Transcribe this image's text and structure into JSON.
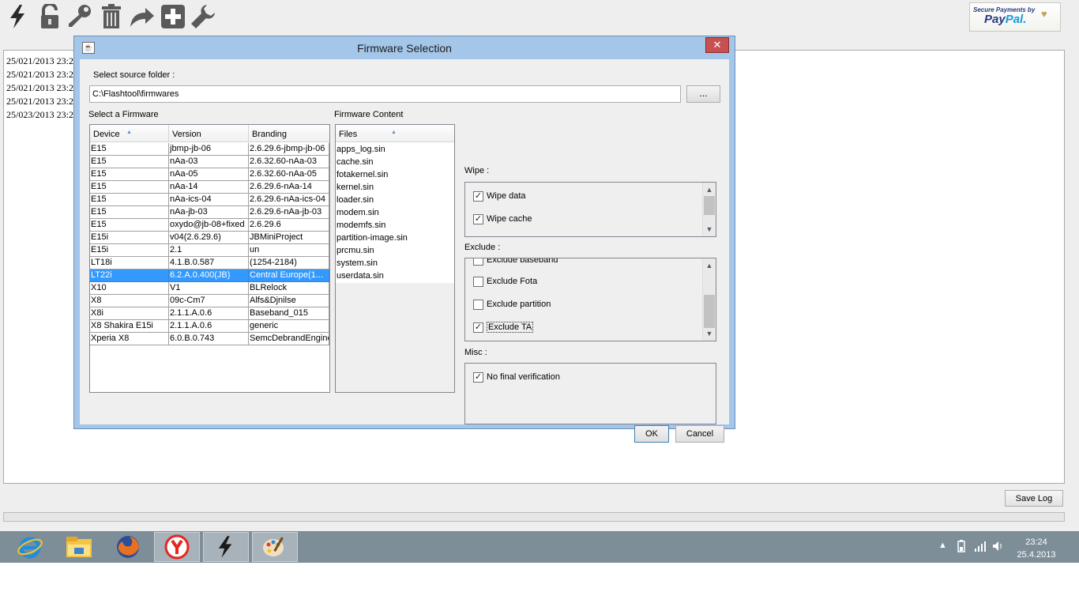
{
  "toolbar": {
    "icons": [
      "flash-icon",
      "unlock-icon",
      "key-icon",
      "trash-icon",
      "redo-arrow-icon",
      "plus-icon",
      "wrench-icon"
    ]
  },
  "paypal": {
    "small": "Secure Payments by",
    "pay": "Pay",
    "pal": "Pal."
  },
  "log": {
    "lines": [
      "25/021/2013 23:2",
      "25/021/2013 23:2",
      "25/021/2013 23:2",
      "25/021/2013 23:2",
      "25/023/2013 23:2"
    ],
    "save_label": "Save Log"
  },
  "dialog": {
    "title": "Firmware Selection",
    "close": "✕",
    "source_label": "Select source folder :",
    "source_path": "C:\\Flashtool\\firmwares",
    "browse_label": "...",
    "select_label": "Select a Firmware",
    "content_label": "Firmware Content",
    "columns": [
      "Device",
      "Version",
      "Branding"
    ],
    "rows": [
      [
        "E15",
        "jbmp-jb-06",
        "2.6.29.6-jbmp-jb-06"
      ],
      [
        "E15",
        "nAa-03",
        "2.6.32.60-nAa-03"
      ],
      [
        "E15",
        "nAa-05",
        "2.6.32.60-nAa-05"
      ],
      [
        "E15",
        "nAa-14",
        "2.6.29.6-nAa-14"
      ],
      [
        "E15",
        "nAa-ics-04",
        "2.6.29.6-nAa-ics-04"
      ],
      [
        "E15",
        "nAa-jb-03",
        "2.6.29.6-nAa-jb-03"
      ],
      [
        "E15",
        "oxydo@jb-08+fixed",
        "2.6.29.6"
      ],
      [
        "E15i",
        "v04(2.6.29.6)",
        "JBMiniProject"
      ],
      [
        "E15i",
        "2.1",
        "un"
      ],
      [
        "LT18i",
        "4.1.B.0.587",
        "(1254-2184)"
      ],
      [
        "LT22i",
        "6.2.A.0.400(JB)",
        "Central Europe(1..."
      ],
      [
        "X10",
        "V1",
        "BLRelock"
      ],
      [
        "X8",
        "09c-Cm7",
        "Alfs&Djnilse"
      ],
      [
        "X8i",
        "2.1.1.A.0.6",
        "Baseband_015"
      ],
      [
        "X8 Shakira E15i",
        "2.1.1.A.0.6",
        "generic"
      ],
      [
        "Xperia X8",
        "6.0.B.0.743",
        "SemcDebrandEngine"
      ]
    ],
    "selected_row": 10,
    "files_header": "Files",
    "files": [
      "apps_log.sin",
      "cache.sin",
      "fotakernel.sin",
      "kernel.sin",
      "loader.sin",
      "modem.sin",
      "modemfs.sin",
      "partition-image.sin",
      "prcmu.sin",
      "system.sin",
      "userdata.sin"
    ],
    "wipe_label": "Wipe :",
    "wipe_options": [
      {
        "label": "Wipe data",
        "checked": true
      },
      {
        "label": "Wipe cache",
        "checked": true
      }
    ],
    "exclude_label": "Exclude :",
    "exclude_options": [
      {
        "label": "Exclude baseband",
        "checked": false
      },
      {
        "label": "Exclude Fota",
        "checked": false
      },
      {
        "label": "Exclude partition",
        "checked": false
      },
      {
        "label": "Exclude TA",
        "checked": true
      }
    ],
    "misc_label": "Misc :",
    "misc_options": [
      {
        "label": "No final verification",
        "checked": true
      }
    ],
    "ok_label": "OK",
    "cancel_label": "Cancel"
  },
  "taskbar": {
    "apps": [
      "internet-explorer-icon",
      "file-explorer-icon",
      "firefox-icon",
      "yandex-browser-icon",
      "flashtool-icon",
      "paint-icon"
    ],
    "time": "23:24",
    "date": "25.4.2013"
  },
  "colors": {
    "selection": "#3399ff",
    "dialog_frame": "#a3c6e9",
    "close_button": "#c75050",
    "taskbar": "#7e8e99"
  }
}
